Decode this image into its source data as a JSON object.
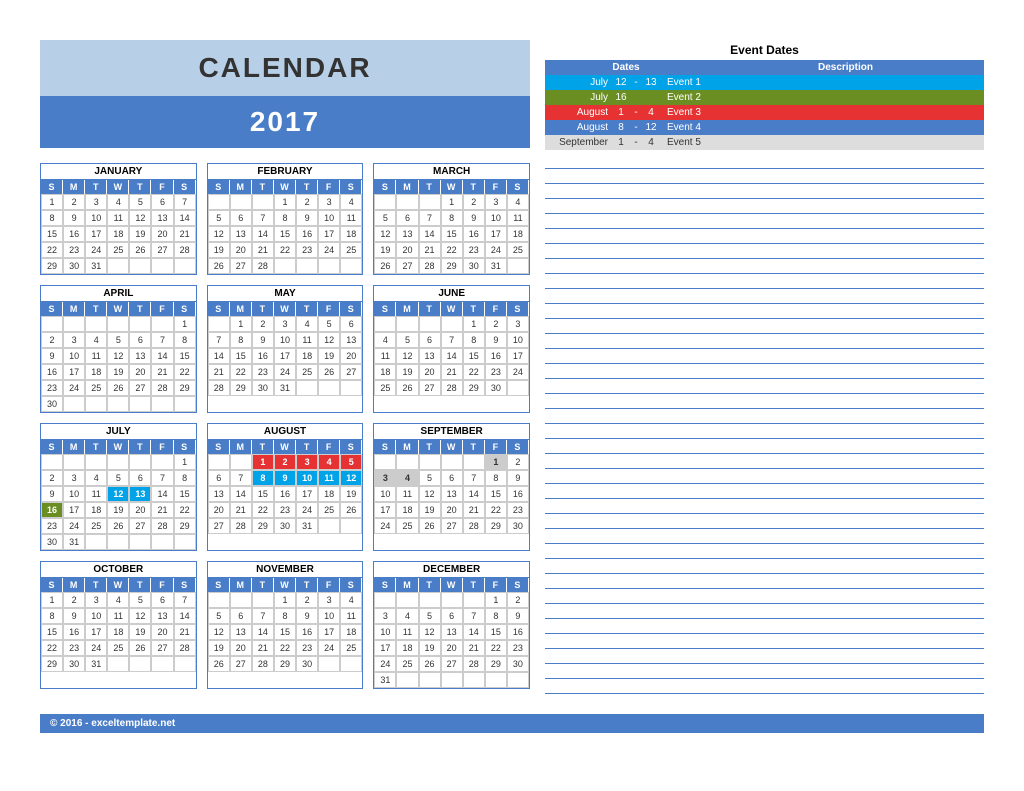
{
  "title": {
    "line1": "CALENDAR",
    "line2": "2017"
  },
  "dayHeaders": [
    "S",
    "M",
    "T",
    "W",
    "T",
    "F",
    "S"
  ],
  "months": [
    {
      "name": "JANUARY",
      "offset": 0,
      "days": 31
    },
    {
      "name": "FEBRUARY",
      "offset": 3,
      "days": 28
    },
    {
      "name": "MARCH",
      "offset": 3,
      "days": 31
    },
    {
      "name": "APRIL",
      "offset": 6,
      "days": 30
    },
    {
      "name": "MAY",
      "offset": 1,
      "days": 31
    },
    {
      "name": "JUNE",
      "offset": 4,
      "days": 30
    },
    {
      "name": "JULY",
      "offset": 6,
      "days": 31
    },
    {
      "name": "AUGUST",
      "offset": 2,
      "days": 31
    },
    {
      "name": "SEPTEMBER",
      "offset": 5,
      "days": 30
    },
    {
      "name": "OCTOBER",
      "offset": 0,
      "days": 31
    },
    {
      "name": "NOVEMBER",
      "offset": 3,
      "days": 30
    },
    {
      "name": "DECEMBER",
      "offset": 5,
      "days": 31
    }
  ],
  "highlights": {
    "JULY": {
      "12": "hl-blue",
      "13": "hl-blue",
      "16": "hl-green"
    },
    "AUGUST": {
      "1": "hl-red",
      "2": "hl-red",
      "3": "hl-red",
      "4": "hl-red",
      "5": "hl-red",
      "8": "hl-blue",
      "9": "hl-blue",
      "10": "hl-blue",
      "11": "hl-blue",
      "12": "hl-blue"
    },
    "SEPTEMBER": {
      "1": "hl-grey",
      "3": "hl-grey",
      "4": "hl-grey"
    }
  },
  "eventsTitle": "Event Dates",
  "eventsHeader": {
    "dates": "Dates",
    "desc": "Description"
  },
  "events": [
    {
      "class": "ev-blue",
      "month": "July",
      "d1": "12",
      "dash": "-",
      "d2": "13",
      "desc": "Event 1"
    },
    {
      "class": "ev-green",
      "month": "July",
      "d1": "16",
      "dash": "",
      "d2": "",
      "desc": "Event 2"
    },
    {
      "class": "ev-red",
      "month": "August",
      "d1": "1",
      "dash": "-",
      "d2": "4",
      "desc": "Event 3"
    },
    {
      "class": "ev-midblue",
      "month": "August",
      "d1": "8",
      "dash": "-",
      "d2": "12",
      "desc": "Event 4"
    },
    {
      "class": "ev-grey",
      "month": "September",
      "d1": "1",
      "dash": "-",
      "d2": "4",
      "desc": "Event 5"
    }
  ],
  "ruledLines": 36,
  "footer": "© 2016 - exceltemplate.net"
}
